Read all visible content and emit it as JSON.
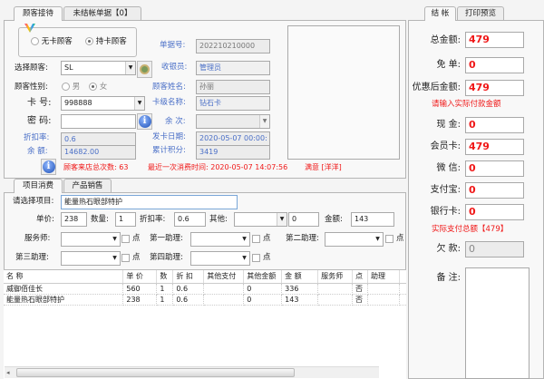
{
  "left_tabs": [
    "顾客接待",
    "未结帐单据【0】"
  ],
  "customer_type": {
    "options": [
      "无卡顾客",
      "持卡顾客"
    ],
    "selected": "持卡顾客"
  },
  "form": {
    "bill_no_label": "单据号:",
    "bill_no": "202210210000",
    "select_customer_label": "选择顾客:",
    "select_customer": "SL",
    "cashier_label": "收银员:",
    "cashier": "管理员",
    "gender_label": "顾客性别:",
    "gender_options": [
      "男",
      "女"
    ],
    "gender": "女",
    "customer_name_label": "顾客姓名:",
    "customer_name": "孙丽",
    "card_no_label": "卡 号:",
    "card_no": "998888",
    "card_level_label": "卡级名称:",
    "card_level": "钻石卡",
    "password_label": "密 码:",
    "password": "",
    "remaining_times_label": "余 次:",
    "remaining_times": "",
    "discount_label": "折扣率:",
    "discount": "0.6",
    "issue_date_label": "发卡日期:",
    "issue_date": "2020-05-07 00:00:",
    "balance_label": "余 额:",
    "balance": "14682.00",
    "points_label": "累计积分:",
    "points": "3419"
  },
  "visit_info": {
    "visits": "顾客来店总次数: 63",
    "last_visit": "最近一次消费时间: 2020-05-07 14:07:56",
    "satisfaction": "满意 [洋洋]"
  },
  "sub_tabs": [
    "项目消费",
    "产品销售"
  ],
  "item": {
    "select_label": "请选择项目:",
    "select_value": "能量热石眼部特护",
    "price_label": "单价:",
    "price": "238",
    "qty_label": "数量:",
    "qty": "1",
    "discount_label": "折扣率:",
    "discount": "0.6",
    "other_label": "其他:",
    "other_select": "",
    "other_value": "0",
    "amount_label": "金额:",
    "amount": "143",
    "staff": [
      {
        "label": "服务师:"
      },
      {
        "label": "第一助理:"
      },
      {
        "label": "第二助理:"
      },
      {
        "label": "第三助理:"
      },
      {
        "label": "第四助理:"
      }
    ],
    "point_label": "点"
  },
  "table": {
    "columns": [
      "名 称",
      "单 价",
      "数",
      "折 扣",
      "其他支付",
      "其他金额",
      "金 额",
      "服务师",
      "点",
      "助理",
      ""
    ],
    "rows": [
      [
        "威御佰佳长",
        "560",
        "1",
        "0.6",
        "",
        "0",
        "336",
        "",
        "否",
        "",
        ""
      ],
      [
        "能量热石眼部特护",
        "238",
        "1",
        "0.6",
        "",
        "0",
        "143",
        "",
        "否",
        "",
        ""
      ]
    ]
  },
  "right_tabs": [
    "结 帐",
    "打印预览"
  ],
  "checkout": {
    "total_label": "总金额:",
    "total": "479",
    "free_label": "免 单:",
    "free": "0",
    "after_discount_label": "优惠后金额:",
    "after_discount": "479",
    "prompt": "请输入实际付款金额",
    "cash_label": "现 金:",
    "cash": "0",
    "member_card_label": "会员卡:",
    "member_card": "479",
    "wechat_label": "微 信:",
    "wechat": "0",
    "alipay_label": "支付宝:",
    "alipay": "0",
    "bank_card_label": "银行卡:",
    "bank_card": "0",
    "actual_total": "实际支付总额【479】",
    "debt_label": "欠 款:",
    "debt": "0",
    "remark_label": "备 注:",
    "remark": ""
  }
}
